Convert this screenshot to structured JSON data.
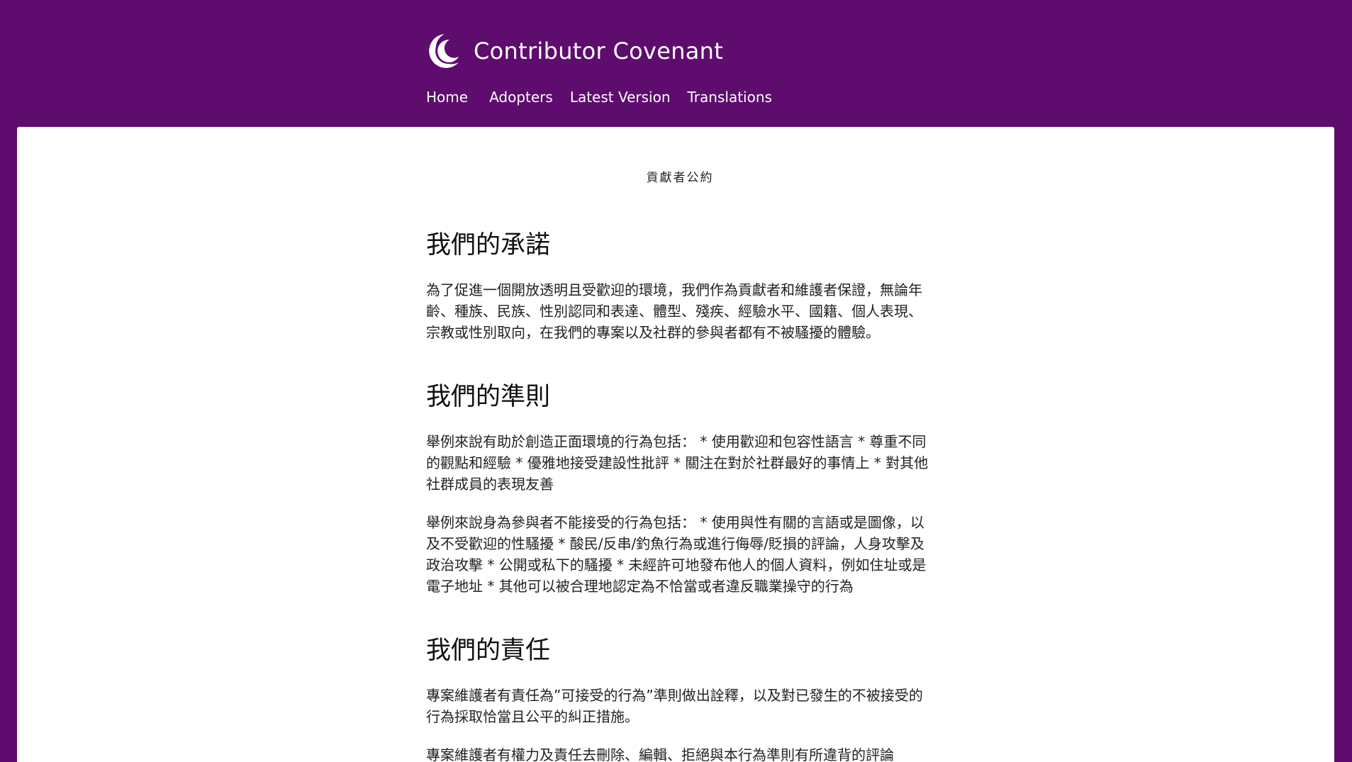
{
  "header": {
    "site_title": "Contributor Covenant",
    "logo_icon": "crescent-moon-logo-icon",
    "nav": [
      {
        "label": "Home"
      },
      {
        "label": "Adopters"
      },
      {
        "label": "Latest Version"
      },
      {
        "label": "Translations"
      }
    ]
  },
  "colors": {
    "brand_purple": "#5e0c6e",
    "card_background": "#ffffff",
    "text": "#222222"
  },
  "document": {
    "title": "貢獻者公約",
    "sections": [
      {
        "heading": "我們的承諾",
        "paragraphs": [
          "為了促進一個開放透明且受歡迎的環境，我們作為貢獻者和維護者保證，無論年齡、種族、民族、性別認同和表達、體型、殘疾、經驗水平、國籍、個人表現、宗教或性別取向，在我們的專案以及社群的參與者都有不被騷擾的體驗。"
        ]
      },
      {
        "heading": "我們的準則",
        "paragraphs": [
          "舉例來說有助於創造正面環境的行為包括： * 使用歡迎和包容性語言 * 尊重不同的觀點和經驗 * 優雅地接受建設性批評 * 關注在對於社群最好的事情上 * 對其他社群成員的表現友善",
          "舉例來說身為參與者不能接受的行為包括： * 使用與性有關的言語或是圖像，以及不受歡迎的性騷擾 * 酸民/反串/釣魚行為或進行侮辱/貶損的評論，人身攻擊及政治攻擊 * 公開或私下的騷擾 * 未經許可地發布他人的個人資料，例如住址或是電子地址 * 其他可以被合理地認定為不恰當或者違反職業操守的行為"
        ]
      },
      {
        "heading": "我們的責任",
        "paragraphs": [
          "專案維護者有責任為”可接受的行為”準則做出詮釋，以及對已發生的不被接受的行為採取恰當且公平的糾正措施。",
          "專案維護者有權力及責任去刪除、編輯、拒絕與本行為準則有所違背的評論"
        ]
      }
    ]
  }
}
